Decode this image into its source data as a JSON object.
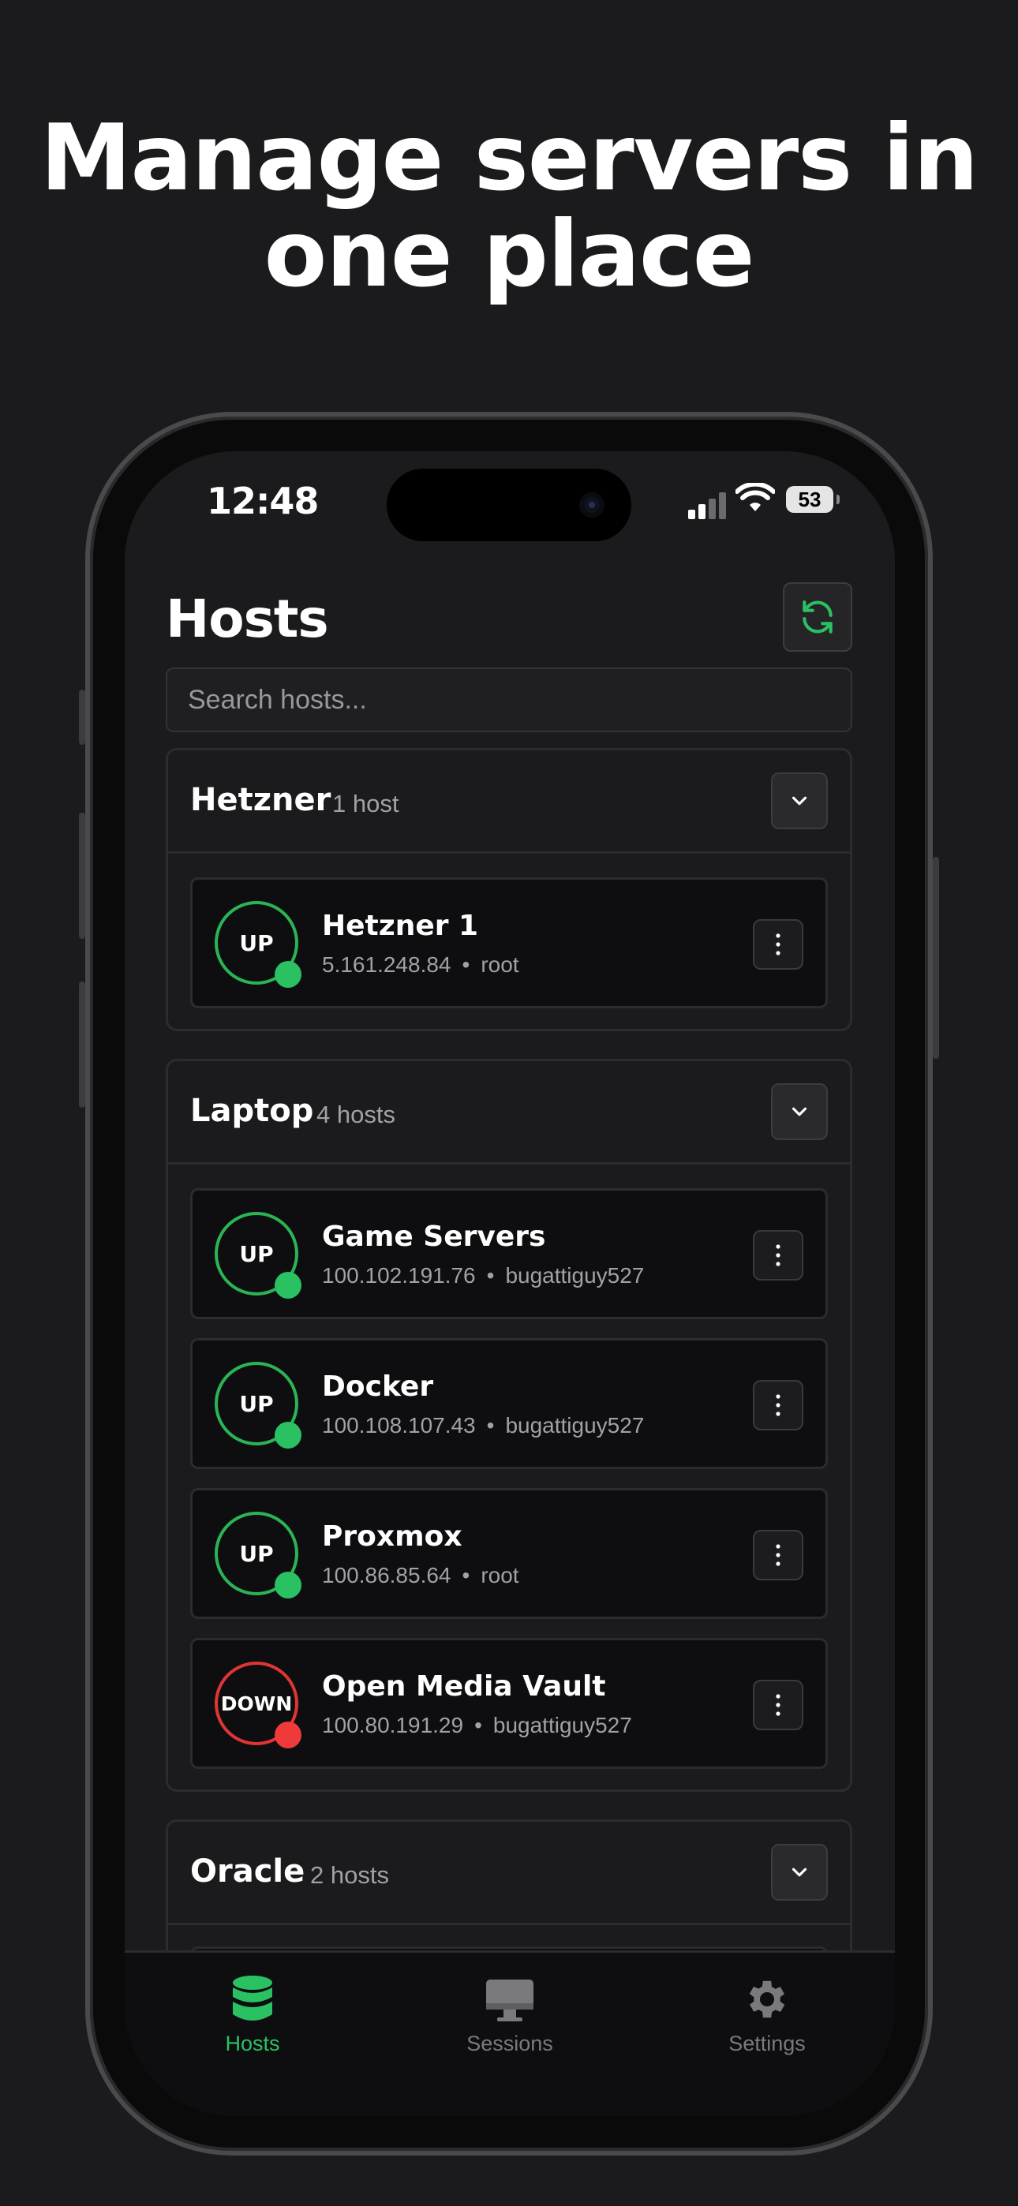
{
  "headline": {
    "line1": "Manage servers in",
    "line2": "one place"
  },
  "status_bar": {
    "time": "12:48",
    "battery": "53"
  },
  "header": {
    "title": "Hosts",
    "refresh_icon": "refresh-icon"
  },
  "search": {
    "placeholder": "Search hosts..."
  },
  "groups": [
    {
      "name": "Hetzner",
      "count": "1 host",
      "hosts": [
        {
          "name": "Hetzner 1",
          "ip": "5.161.248.84",
          "user": "root",
          "status": "UP"
        }
      ]
    },
    {
      "name": "Laptop",
      "count": "4 hosts",
      "hosts": [
        {
          "name": "Game Servers",
          "ip": "100.102.191.76",
          "user": "bugattiguy527",
          "status": "UP"
        },
        {
          "name": "Docker",
          "ip": "100.108.107.43",
          "user": "bugattiguy527",
          "status": "UP"
        },
        {
          "name": "Proxmox",
          "ip": "100.86.85.64",
          "user": "root",
          "status": "UP"
        },
        {
          "name": "Open Media Vault",
          "ip": "100.80.191.29",
          "user": "bugattiguy527",
          "status": "DOWN"
        }
      ]
    },
    {
      "name": "Oracle",
      "count": "2 hosts",
      "hosts": []
    }
  ],
  "meta_separator": "•",
  "tabs": [
    {
      "label": "Hosts",
      "icon": "database-icon",
      "active": true
    },
    {
      "label": "Sessions",
      "icon": "monitor-icon",
      "active": false
    },
    {
      "label": "Settings",
      "icon": "gear-icon",
      "active": false
    }
  ],
  "colors": {
    "accent": "#2ac163",
    "up": "#2ab456",
    "down": "#e03535",
    "background": "#1b1b1d"
  }
}
